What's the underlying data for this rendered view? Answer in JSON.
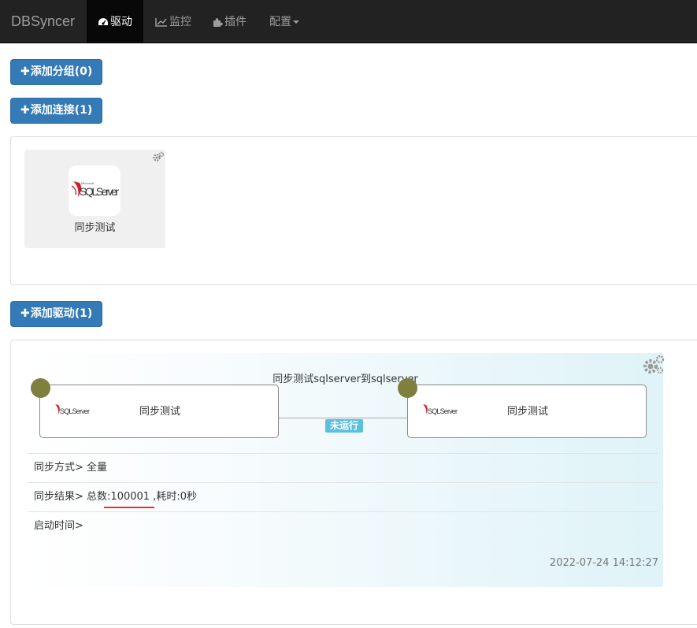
{
  "navbar": {
    "brand": "DBSyncer",
    "items": [
      {
        "label": "驱动",
        "icon": "dashboard-icon",
        "active": true
      },
      {
        "label": "监控",
        "icon": "line-chart-icon",
        "active": false
      },
      {
        "label": "插件",
        "icon": "puzzle-icon",
        "active": false
      },
      {
        "label": "配置",
        "icon": "caret-down-icon",
        "active": false
      }
    ]
  },
  "buttons": {
    "add_group": "添加分组(0)",
    "add_connection": "添加连接(1)",
    "add_driver": "添加驱动(1)"
  },
  "connections": [
    {
      "name": "同步测试",
      "logo_text_small": "Microsoft",
      "logo_text": "SQLServer"
    }
  ],
  "driver": {
    "title": "同步测试sqlserver到sqlserver",
    "source": {
      "name": "同步测试",
      "logo_text": "SQLServer"
    },
    "target": {
      "name": "同步测试",
      "logo_text": "SQLServer"
    },
    "status": "未运行",
    "sync_mode_label": "同步方式>",
    "sync_mode_value": "全量",
    "sync_result_label": "同步结果>",
    "sync_result_value": "总数:100001 ,耗时:0秒",
    "start_time_label": "启动时间>",
    "start_time_value": "",
    "timestamp": "2022-07-24 14:12:27"
  },
  "colors": {
    "navbar_bg": "#222222",
    "button_primary": "#337ab7",
    "status_badge": "#5bc0de",
    "node_dot": "#7f7f40",
    "underline": "#e3342f"
  }
}
